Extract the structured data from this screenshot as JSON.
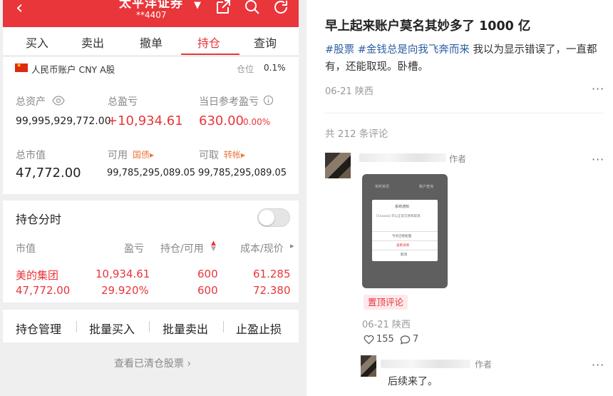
{
  "app": {
    "header": {
      "back": "‹",
      "title": "太平洋证券",
      "account_masked": "**4407"
    },
    "tabs": [
      "买入",
      "卖出",
      "撤单",
      "持仓",
      "查询"
    ],
    "active_tab": "持仓",
    "account": {
      "type": "人民币账户 CNY A股",
      "position_label": "仓位",
      "position_value": "0.1%"
    },
    "summary": {
      "total_assets_label": "总资产",
      "total_assets": "99,995,929,772.00",
      "total_pnl_label": "总盈亏",
      "total_pnl": "+10,934.61",
      "day_pnl_label": "当日参考盈亏",
      "day_pnl": "630.00",
      "day_pnl_pct": "0.00%",
      "market_value_label": "总市值",
      "market_value": "47,772.00",
      "available_label": "可用",
      "available_tag": "国债",
      "available": "99,785,295,089.05",
      "withdrawable_label": "可取",
      "withdrawable_tag": "转帐",
      "withdrawable": "99,785,295,089.05"
    },
    "holdings": {
      "title": "持仓分时",
      "headers": {
        "market_value": "市值",
        "pnl": "盈亏",
        "qty": "持仓/可用",
        "cost": "成本/现价"
      },
      "rows": [
        {
          "name": "美的集团",
          "market_value": "47,772.00",
          "pnl": "10,934.61",
          "pnl_pct": "29.920%",
          "qty": "600",
          "available": "600",
          "cost": "61.285",
          "price": "72.380"
        }
      ]
    },
    "actions": [
      "持仓管理",
      "批量买入",
      "批量卖出",
      "止盈止损"
    ],
    "footer_link": "查看已清仓股票 ›"
  },
  "post": {
    "title": "早上起来账户莫名其妙多了 1000 亿",
    "tags": [
      "#股票",
      "#金钱总是向我飞奔而来"
    ],
    "body": "我以为显示错误了，一直都有，还能取现。卧槽。",
    "date": "06-21",
    "location": "陕西",
    "comments_count_text": "共 212 条评论",
    "comments": [
      {
        "author_badge": "作者",
        "image_texts": {
          "top_left": "实时资讯",
          "top_right": "账户查询",
          "card_title": "系统通知",
          "card_body": "[1xxxxx] 可以正常交易和取现",
          "opt1": "今天已经处理",
          "opt2": "查看详情",
          "opt3": "取消"
        },
        "pinned_label": "置顶评论",
        "date": "06-21",
        "location": "陕西",
        "likes": "155",
        "replies": "7"
      }
    ],
    "reply": {
      "author_badge": "作者",
      "text": "后续来了。"
    }
  },
  "colors": {
    "brand_red": "#e8363b",
    "tag_blue": "#2a5ea3",
    "orange_tag": "#e8763b"
  }
}
